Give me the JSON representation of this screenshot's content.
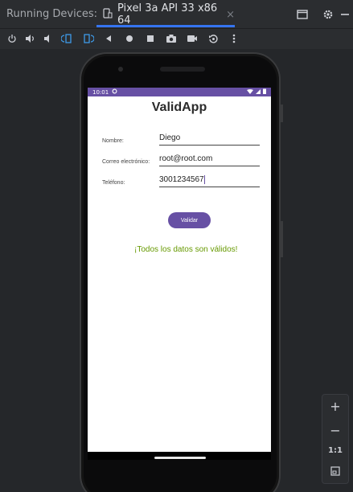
{
  "header": {
    "panel_title": "Running Devices:",
    "tab_label": "Pixel 3a API 33 x86 64",
    "tab_close": "×"
  },
  "toolbar": {
    "icons": [
      "power-icon",
      "volume-up-icon",
      "volume-down-icon",
      "rotate-left-icon",
      "rotate-right-icon",
      "back-icon",
      "home-icon",
      "overview-icon",
      "screenshot-icon",
      "screen-record-icon",
      "snapshot-icon",
      "more-icon"
    ]
  },
  "phone": {
    "status_time": "10:01"
  },
  "app": {
    "title": "ValidApp",
    "fields": [
      {
        "label": "Nombre:",
        "value": "Diego"
      },
      {
        "label": "Correo electrónico:",
        "value": "root@root.com"
      },
      {
        "label": "Teléfono:",
        "value": "3001234567"
      }
    ],
    "button": "Validar",
    "result": "¡Todos los datos son válidos!"
  },
  "zoom": {
    "zoom_in": "+",
    "zoom_out": "−",
    "actual_size": "1:1"
  },
  "colors": {
    "accent": "#6750a4",
    "success": "#669900",
    "ide_bg": "#2b2d30"
  }
}
